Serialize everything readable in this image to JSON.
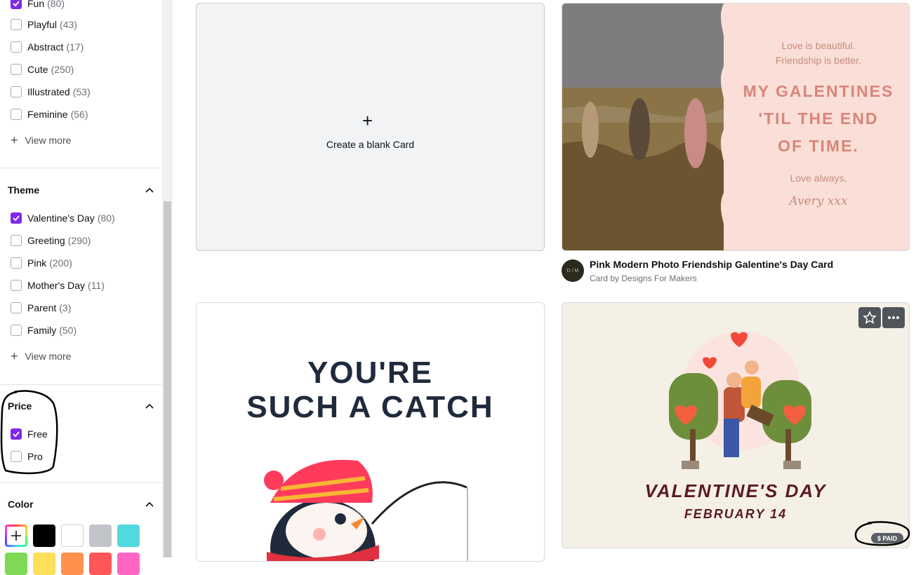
{
  "sidebar": {
    "style_options": [
      {
        "label": "Fun",
        "count": "(80)",
        "checked": true
      },
      {
        "label": "Playful",
        "count": "(43)",
        "checked": false
      },
      {
        "label": "Abstract",
        "count": "(17)",
        "checked": false
      },
      {
        "label": "Cute",
        "count": "(250)",
        "checked": false
      },
      {
        "label": "Illustrated",
        "count": "(53)",
        "checked": false
      },
      {
        "label": "Feminine",
        "count": "(56)",
        "checked": false
      }
    ],
    "view_more": "View more",
    "theme": {
      "title": "Theme",
      "options": [
        {
          "label": "Valentine's Day",
          "count": "(80)",
          "checked": true
        },
        {
          "label": "Greeting",
          "count": "(290)",
          "checked": false
        },
        {
          "label": "Pink",
          "count": "(200)",
          "checked": false
        },
        {
          "label": "Mother's Day",
          "count": "(11)",
          "checked": false
        },
        {
          "label": "Parent",
          "count": "(3)",
          "checked": false
        },
        {
          "label": "Family",
          "count": "(50)",
          "checked": false
        }
      ]
    },
    "price": {
      "title": "Price",
      "options": [
        {
          "label": "Free",
          "checked": true
        },
        {
          "label": "Pro",
          "checked": false
        }
      ]
    },
    "color": {
      "title": "Color",
      "swatches_row1": [
        "custom",
        "#000000",
        "#ffffff",
        "#c1c4c8",
        "#52d9dd"
      ],
      "swatches_row2": [
        "#7ed957",
        "#ffde59",
        "#ff914d",
        "#ff5757",
        "#ff66c4"
      ]
    }
  },
  "main": {
    "blank_card_label": "Create a blank Card",
    "template1": {
      "line1": "Love is beautiful.",
      "line2": "Friendship is better.",
      "headline1": "MY GALENTINES",
      "headline2": "'TIL THE END",
      "headline3": "OF TIME.",
      "closing": "Love always,",
      "signature": "Avery xxx",
      "title": "Pink Modern Photo Friendship Galentine's Day Card",
      "subtitle": "Card by Designs For Makers",
      "avatar_text": "D / M"
    },
    "template2": {
      "line1": "YOU'RE",
      "line2": "SUCH A CATCH"
    },
    "template3": {
      "headline": "VALENTINE'S DAY",
      "date": "FEBRUARY 14",
      "badge": "$ PAID"
    }
  }
}
